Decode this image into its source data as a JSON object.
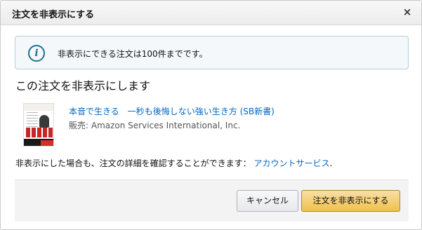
{
  "dialog": {
    "title": "注文を非表示にする",
    "close_glyph": "×"
  },
  "info": {
    "icon_glyph": "i",
    "message": "非表示にできる注文は100件までです。"
  },
  "heading": "この注文を非表示にします",
  "item": {
    "title": "本音で生きる　一秒も後悔しない強い生き方 (SB新書)",
    "seller": "販売: Amazon Services International, Inc."
  },
  "note": {
    "text": "非表示にした場合も、注文の詳細を確認することができます：",
    "link": "アカウントサービス",
    "period": "."
  },
  "buttons": {
    "cancel": "キャンセル",
    "hide": "注文を非表示にする"
  },
  "colors": {
    "link": "#0066c0",
    "primary_button": "#f0c14b",
    "info_icon": "#1f6f95",
    "info_border": "#b6cfdb"
  }
}
